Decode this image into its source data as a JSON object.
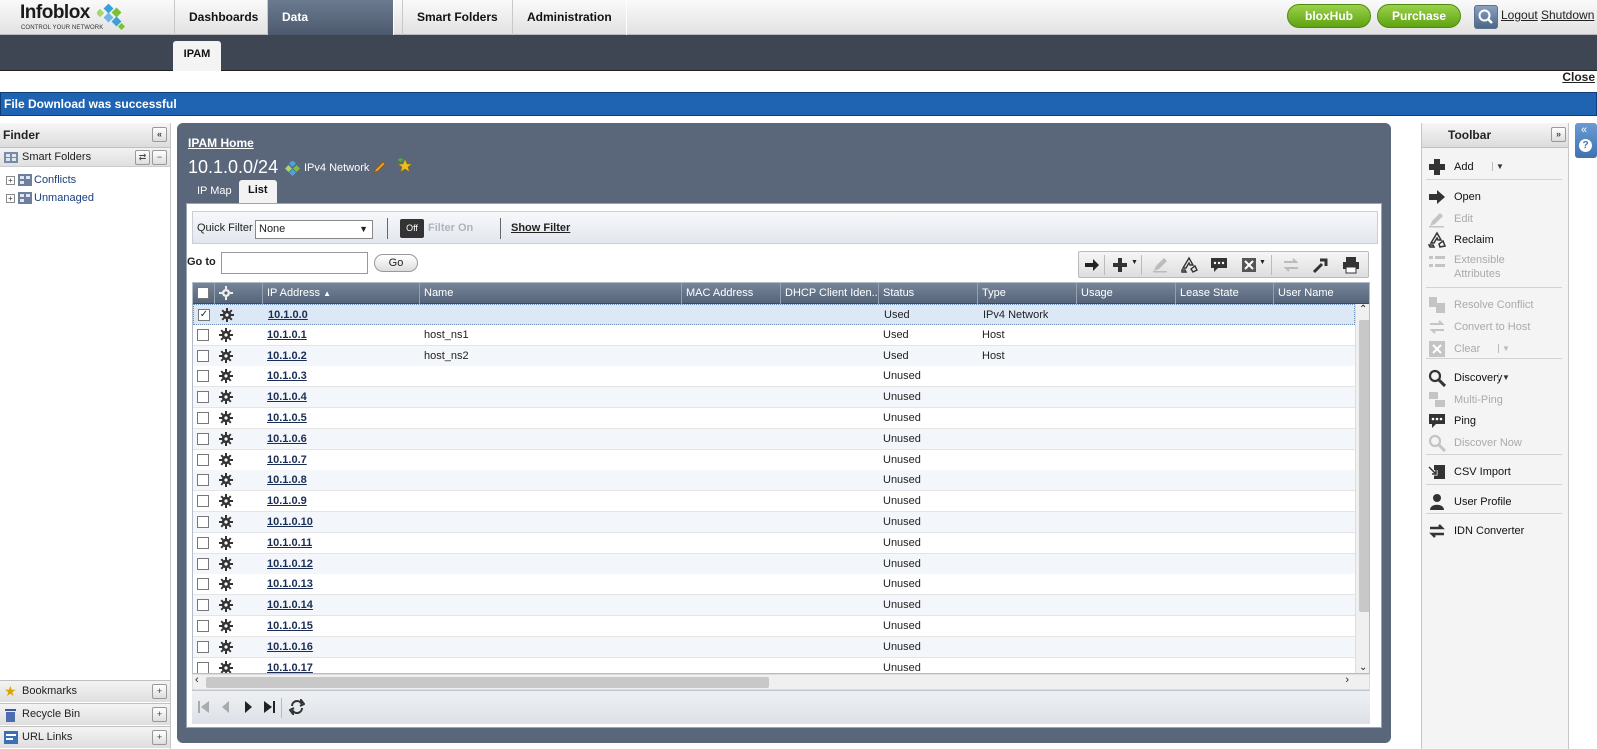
{
  "app": {
    "logo": {
      "brand": "Infoblox",
      "tagline": "CONTROL YOUR NETWORK"
    },
    "nav_tabs": [
      {
        "label": "Dashboards",
        "active": false
      },
      {
        "label": "Data Management",
        "active": true
      },
      {
        "label": "Smart Folders",
        "active": false
      },
      {
        "label": "Administration",
        "active": false
      }
    ],
    "bloxhub_label": "bloxHub",
    "purchase_label": "Purchase",
    "logout_label": "Logout",
    "shutdown_label": "Shutdown",
    "accent_color": "#6fb523"
  },
  "subnav": {
    "tab": "IPAM"
  },
  "notification": {
    "close_label": "Close",
    "message": "File Download was successful",
    "color": "#1f63b3"
  },
  "finder": {
    "title": "Finder",
    "smart_folders_label": "Smart Folders",
    "tree": [
      "Conflicts",
      "Unmanaged"
    ],
    "bottom": [
      "Bookmarks",
      "Recycle Bin",
      "URL Links"
    ]
  },
  "main": {
    "breadcrumb": "IPAM Home",
    "network": "10.1.0.0/24",
    "network_type": "IPv4 Network",
    "tabs": [
      {
        "label": "IP Map",
        "active": false
      },
      {
        "label": "List",
        "active": true
      }
    ],
    "filter": {
      "quick_filter_label": "Quick Filter",
      "quick_filter_value": "None",
      "off_label": "Off",
      "filter_on_label": "Filter On",
      "show_filter_label": "Show Filter"
    },
    "goto": {
      "label": "Go to",
      "value": "",
      "button": "Go"
    },
    "columns": [
      "IP Address",
      "Name",
      "MAC Address",
      "DHCP Client Iden...",
      "Status",
      "Type",
      "Usage",
      "Lease State",
      "User Name"
    ],
    "rows": [
      {
        "ip": "10.1.0.0",
        "name": "",
        "status": "Used",
        "type": "IPv4 Network",
        "checked": true
      },
      {
        "ip": "10.1.0.1",
        "name": "host_ns1",
        "status": "Used",
        "type": "Host",
        "checked": false
      },
      {
        "ip": "10.1.0.2",
        "name": "host_ns2",
        "status": "Used",
        "type": "Host",
        "checked": false
      },
      {
        "ip": "10.1.0.3",
        "name": "",
        "status": "Unused",
        "type": "",
        "checked": false
      },
      {
        "ip": "10.1.0.4",
        "name": "",
        "status": "Unused",
        "type": "",
        "checked": false
      },
      {
        "ip": "10.1.0.5",
        "name": "",
        "status": "Unused",
        "type": "",
        "checked": false
      },
      {
        "ip": "10.1.0.6",
        "name": "",
        "status": "Unused",
        "type": "",
        "checked": false
      },
      {
        "ip": "10.1.0.7",
        "name": "",
        "status": "Unused",
        "type": "",
        "checked": false
      },
      {
        "ip": "10.1.0.8",
        "name": "",
        "status": "Unused",
        "type": "",
        "checked": false
      },
      {
        "ip": "10.1.0.9",
        "name": "",
        "status": "Unused",
        "type": "",
        "checked": false
      },
      {
        "ip": "10.1.0.10",
        "name": "",
        "status": "Unused",
        "type": "",
        "checked": false
      },
      {
        "ip": "10.1.0.11",
        "name": "",
        "status": "Unused",
        "type": "",
        "checked": false
      },
      {
        "ip": "10.1.0.12",
        "name": "",
        "status": "Unused",
        "type": "",
        "checked": false
      },
      {
        "ip": "10.1.0.13",
        "name": "",
        "status": "Unused",
        "type": "",
        "checked": false
      },
      {
        "ip": "10.1.0.14",
        "name": "",
        "status": "Unused",
        "type": "",
        "checked": false
      },
      {
        "ip": "10.1.0.15",
        "name": "",
        "status": "Unused",
        "type": "",
        "checked": false
      },
      {
        "ip": "10.1.0.16",
        "name": "",
        "status": "Unused",
        "type": "",
        "checked": false
      },
      {
        "ip": "10.1.0.17",
        "name": "",
        "status": "Unused",
        "type": "",
        "checked": false
      }
    ]
  },
  "toolbar": {
    "title": "Toolbar",
    "items": [
      {
        "label": "Add",
        "enabled": true,
        "icon": "plus-icon"
      },
      {
        "label": "Open",
        "enabled": true,
        "icon": "arrow-right-icon"
      },
      {
        "label": "Edit",
        "enabled": false,
        "icon": "edit-icon"
      },
      {
        "label": "Reclaim",
        "enabled": true,
        "icon": "recycle-icon"
      },
      {
        "label": "Extensible Attributes",
        "enabled": false,
        "icon": "attributes-icon"
      },
      {
        "label": "Resolve Conflict",
        "enabled": false,
        "icon": "resolve-icon"
      },
      {
        "label": "Convert to Host",
        "enabled": false,
        "icon": "convert-icon"
      },
      {
        "label": "Clear",
        "enabled": false,
        "icon": "clear-icon"
      },
      {
        "label": "Discovery",
        "enabled": true,
        "icon": "discovery-icon"
      },
      {
        "label": "Multi-Ping",
        "enabled": false,
        "icon": "multi-ping-icon"
      },
      {
        "label": "Ping",
        "enabled": true,
        "icon": "ping-icon"
      },
      {
        "label": "Discover Now",
        "enabled": false,
        "icon": "discover-now-icon"
      },
      {
        "label": "CSV Import",
        "enabled": true,
        "icon": "csv-import-icon"
      },
      {
        "label": "User Profile",
        "enabled": true,
        "icon": "user-icon"
      },
      {
        "label": "IDN Converter",
        "enabled": true,
        "icon": "idn-icon"
      }
    ]
  }
}
